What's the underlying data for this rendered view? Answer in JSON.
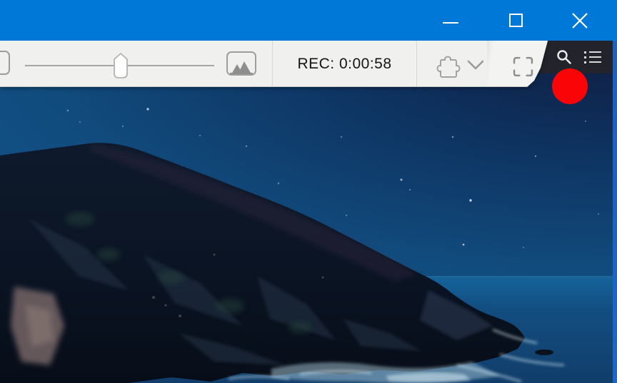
{
  "titlebar": {
    "background_color": "#0078d7",
    "controls": [
      {
        "name": "minimize",
        "icon": "minimize-icon"
      },
      {
        "name": "maximize",
        "icon": "maximize-icon"
      },
      {
        "name": "close",
        "icon": "close-icon"
      }
    ]
  },
  "toolbar": {
    "background_color": "#f0f0ee",
    "recording_status": "REC: 0:00:58",
    "slider": {
      "value_percent": 50
    },
    "icons": [
      "annotate-icon",
      "image-icon",
      "puzzle-icon",
      "chevron-down-icon",
      "fullscreen-icon"
    ]
  },
  "browser_chrome": {
    "background_color": "#23242b",
    "icons": [
      "search-icon",
      "list-icon"
    ]
  },
  "record_button": {
    "color": "#fa0407"
  },
  "window_border": {
    "color": "#1b66cc"
  },
  "wallpaper": {
    "alt": "Night coastal mountains with starry sky and ocean"
  }
}
